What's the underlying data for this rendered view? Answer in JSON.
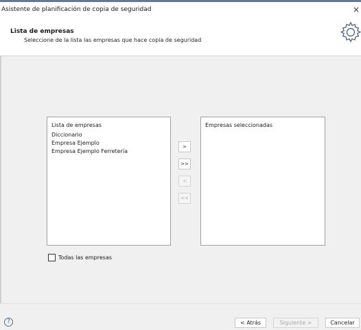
{
  "window": {
    "title": "Asistente de planificación de copia de seguridad",
    "close_glyph": "×"
  },
  "header": {
    "title": "Lista de empresas",
    "subtitle": "Seleccione de la lista las empresas que hace copia de seguridad",
    "icon": "gear-icon"
  },
  "available_list": {
    "header": "Lista de empresas",
    "items": [
      "Diccionario",
      "Empresa Ejemplo",
      "Empresa Ejemplo Ferretería"
    ]
  },
  "selected_list": {
    "header": "Empresas seleccionadas",
    "items": []
  },
  "move_buttons": {
    "add_one": ">",
    "add_all": ">>",
    "remove_one": "<",
    "remove_all": "<<"
  },
  "all_companies": {
    "label": "Todas las empresas",
    "checked": false
  },
  "footer": {
    "help_glyph": "?",
    "back": "< Atrás",
    "next": "Siguiente >",
    "cancel": "Cancelar"
  }
}
